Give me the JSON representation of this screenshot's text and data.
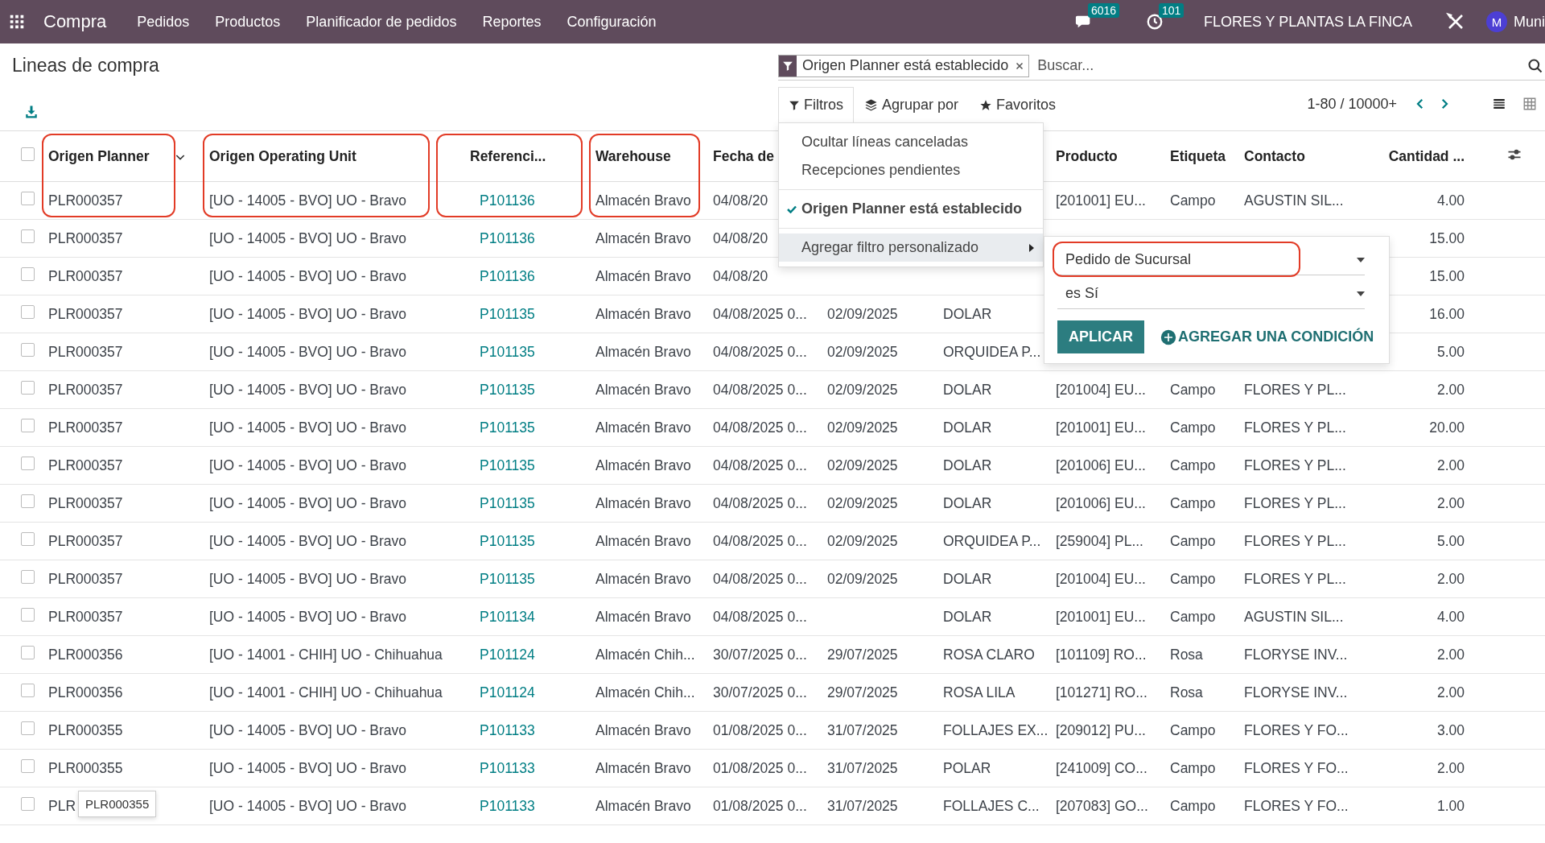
{
  "navbar": {
    "app": "Compra",
    "menu": [
      "Pedidos",
      "Productos",
      "Planificador de pedidos",
      "Reportes",
      "Configuración"
    ],
    "messages_count": "6016",
    "activities_count": "101",
    "company": "FLORES Y PLANTAS LA FINCA",
    "user_initial": "M",
    "user_name": "Muni"
  },
  "page_title": "Lineas de compra",
  "search": {
    "facet": "Origen Planner está establecido",
    "placeholder": "Buscar..."
  },
  "search_tabs": [
    {
      "label": "Filtros",
      "selected": true,
      "kind": "filter"
    },
    {
      "label": "Agrupar por",
      "selected": false,
      "kind": "group"
    },
    {
      "label": "Favoritos",
      "selected": false,
      "kind": "star"
    }
  ],
  "pager": "1-80 / 10000+",
  "views": [
    {
      "kind": "list",
      "selected": true
    },
    {
      "kind": "pivot",
      "selected": false
    }
  ],
  "table": {
    "select_all": {
      "checked": false
    },
    "columns": [
      {
        "label": "Origen Planner",
        "kind": "text",
        "highlighted": true,
        "sorted": true
      },
      {
        "label": "Origen Operating Unit",
        "kind": "text",
        "highlighted": true,
        "sorted": false
      },
      {
        "label": "Referenci...",
        "kind": "link",
        "highlighted": true,
        "sorted": false
      },
      {
        "label": "Warehouse",
        "kind": "text",
        "highlighted": true,
        "sorted": false
      },
      {
        "label": "Fecha de",
        "kind": "text",
        "highlighted": false,
        "sorted": false
      },
      {
        "kind": "text"
      },
      {
        "kind": "text"
      },
      {
        "label": "Producto",
        "kind": "text",
        "highlighted": false,
        "sorted": false
      },
      {
        "label": "Etiqueta",
        "kind": "text",
        "highlighted": false,
        "sorted": false
      },
      {
        "label": "Contacto",
        "kind": "text",
        "highlighted": false,
        "sorted": false
      },
      {
        "label": "Cantidad ...",
        "kind": "number",
        "highlighted": false,
        "sorted": false
      }
    ],
    "rows": [
      {
        "checked": false,
        "cells": [
          "PLR000357",
          "[UO - 14005 - BVO] UO - Bravo",
          "P101136",
          "Almacén Bravo",
          "04/08/20",
          null,
          null,
          "[201001] EU...",
          "Campo",
          "AGUSTIN SIL...",
          "4.00"
        ]
      },
      {
        "checked": false,
        "cells": [
          "PLR000357",
          "[UO - 14005 - BVO] UO - Bravo",
          "P101136",
          "Almacén Bravo",
          "04/08/20",
          null,
          null,
          null,
          null,
          null,
          "15.00"
        ]
      },
      {
        "checked": false,
        "cells": [
          "PLR000357",
          "[UO - 14005 - BVO] UO - Bravo",
          "P101136",
          "Almacén Bravo",
          "04/08/20",
          null,
          null,
          null,
          null,
          null,
          "15.00"
        ]
      },
      {
        "checked": false,
        "cells": [
          "PLR000357",
          "[UO - 14005 - BVO] UO - Bravo",
          "P101135",
          "Almacén Bravo",
          "04/08/2025 0...",
          "02/09/2025",
          "DOLAR",
          null,
          null,
          null,
          "16.00"
        ]
      },
      {
        "checked": false,
        "cells": [
          "PLR000357",
          "[UO - 14005 - BVO] UO - Bravo",
          "P101135",
          "Almacén Bravo",
          "04/08/2025 0...",
          "02/09/2025",
          "ORQUIDEA P...",
          null,
          null,
          null,
          "5.00"
        ]
      },
      {
        "checked": false,
        "cells": [
          "PLR000357",
          "[UO - 14005 - BVO] UO - Bravo",
          "P101135",
          "Almacén Bravo",
          "04/08/2025 0...",
          "02/09/2025",
          "DOLAR",
          "[201004] EU...",
          "Campo",
          "FLORES Y PL...",
          "2.00"
        ]
      },
      {
        "checked": false,
        "cells": [
          "PLR000357",
          "[UO - 14005 - BVO] UO - Bravo",
          "P101135",
          "Almacén Bravo",
          "04/08/2025 0...",
          "02/09/2025",
          "DOLAR",
          "[201001] EU...",
          "Campo",
          "FLORES Y PL...",
          "20.00"
        ]
      },
      {
        "checked": false,
        "cells": [
          "PLR000357",
          "[UO - 14005 - BVO] UO - Bravo",
          "P101135",
          "Almacén Bravo",
          "04/08/2025 0...",
          "02/09/2025",
          "DOLAR",
          "[201006] EU...",
          "Campo",
          "FLORES Y PL...",
          "2.00"
        ]
      },
      {
        "checked": false,
        "cells": [
          "PLR000357",
          "[UO - 14005 - BVO] UO - Bravo",
          "P101135",
          "Almacén Bravo",
          "04/08/2025 0...",
          "02/09/2025",
          "DOLAR",
          "[201006] EU...",
          "Campo",
          "FLORES Y PL...",
          "2.00"
        ]
      },
      {
        "checked": false,
        "cells": [
          "PLR000357",
          "[UO - 14005 - BVO] UO - Bravo",
          "P101135",
          "Almacén Bravo",
          "04/08/2025 0...",
          "02/09/2025",
          "ORQUIDEA P...",
          "[259004] PL...",
          "Campo",
          "FLORES Y PL...",
          "5.00"
        ]
      },
      {
        "checked": false,
        "cells": [
          "PLR000357",
          "[UO - 14005 - BVO] UO - Bravo",
          "P101135",
          "Almacén Bravo",
          "04/08/2025 0...",
          "02/09/2025",
          "DOLAR",
          "[201004] EU...",
          "Campo",
          "FLORES Y PL...",
          "2.00"
        ]
      },
      {
        "checked": false,
        "cells": [
          "PLR000357",
          "[UO - 14005 - BVO] UO - Bravo",
          "P101134",
          "Almacén Bravo",
          "04/08/2025 0...",
          null,
          "DOLAR",
          "[201001] EU...",
          "Campo",
          "AGUSTIN SIL...",
          "4.00"
        ]
      },
      {
        "checked": false,
        "cells": [
          "PLR000356",
          "[UO - 14001 - CHIH] UO - Chihuahua",
          "P101124",
          "Almacén Chih...",
          "30/07/2025 0...",
          "29/07/2025",
          "ROSA CLARO",
          "[101109] RO...",
          "Rosa",
          "FLORYSE INV...",
          "2.00"
        ]
      },
      {
        "checked": false,
        "cells": [
          "PLR000356",
          "[UO - 14001 - CHIH] UO - Chihuahua",
          "P101124",
          "Almacén Chih...",
          "30/07/2025 0...",
          "29/07/2025",
          "ROSA LILA",
          "[101271] RO...",
          "Rosa",
          "FLORYSE INV...",
          "2.00"
        ]
      },
      {
        "checked": false,
        "cells": [
          "PLR000355",
          "[UO - 14005 - BVO] UO - Bravo",
          "P101133",
          "Almacén Bravo",
          "01/08/2025 0...",
          "31/07/2025",
          "FOLLAJES EX...",
          "[209012] PU...",
          "Campo",
          "FLORES Y FO...",
          "3.00"
        ]
      },
      {
        "checked": false,
        "cells": [
          "PLR000355",
          "[UO - 14005 - BVO] UO - Bravo",
          "P101133",
          "Almacén Bravo",
          "01/08/2025 0...",
          "31/07/2025",
          "POLAR",
          "[241009] CO...",
          "Campo",
          "FLORES Y FO...",
          "2.00"
        ]
      },
      {
        "checked": false,
        "cells": [
          "PLR",
          "[UO - 14005 - BVO] UO - Bravo",
          "P101133",
          "Almacén Bravo",
          "01/08/2025 0...",
          "31/07/2025",
          "FOLLAJES C...",
          "[207083] GO...",
          "Campo",
          "FLORES Y FO...",
          "1.00"
        ]
      }
    ]
  },
  "filter_menu": {
    "groups": [
      [
        {
          "label": "Ocultar líneas canceladas",
          "kind": "option",
          "checked": false
        },
        {
          "label": "Recepciones pendientes",
          "kind": "option",
          "checked": false
        }
      ],
      [
        {
          "label": "Origen Planner está establecido",
          "kind": "option",
          "checked": true
        }
      ],
      [
        {
          "label": "Agregar filtro personalizado",
          "kind": "submenu",
          "checked": false
        }
      ]
    ]
  },
  "custom_filter": {
    "field": {
      "value": "Pedido de Sucursal",
      "highlighted": true
    },
    "operator": "es Sí",
    "apply": "APLICAR",
    "add_condition": "AGREGAR UNA CONDICIÓN"
  },
  "tooltip": "PLR000355"
}
